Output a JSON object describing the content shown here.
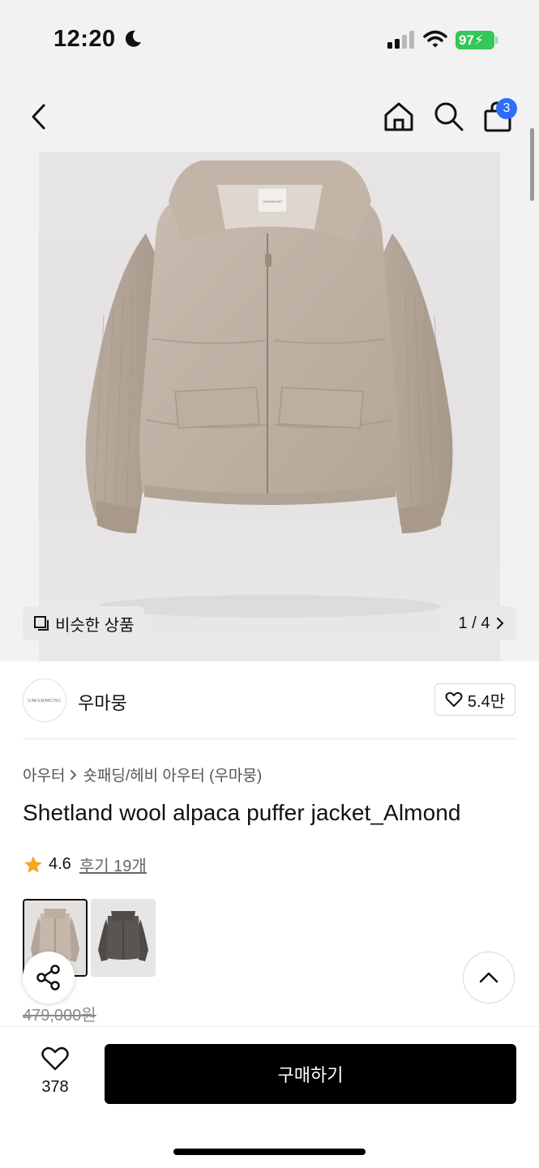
{
  "status_bar": {
    "time": "12:20",
    "battery": "97"
  },
  "header": {
    "cart_count": "3"
  },
  "gallery": {
    "similar_label": "비슷한 상품",
    "pager": "1 / 4",
    "logo_text": "UMARMUNG"
  },
  "brand": {
    "logo_text": "UMARMUNG",
    "name": "우마뭉",
    "likes": "5.4만"
  },
  "breadcrumb": {
    "category": "아우터",
    "subcategory": "숏패딩/헤비 아우터 (우마뭉)"
  },
  "product": {
    "title": "Shetland wool alpaca puffer jacket_Almond",
    "rating": "4.6",
    "reviews": "후기 19개",
    "original_price": "479,000원"
  },
  "bottom": {
    "wish_count": "378",
    "buy_label": "구매하기"
  },
  "colors": {
    "accent_blue": "#2f6df6",
    "battery_green": "#34c759",
    "star": "#f5a623"
  }
}
